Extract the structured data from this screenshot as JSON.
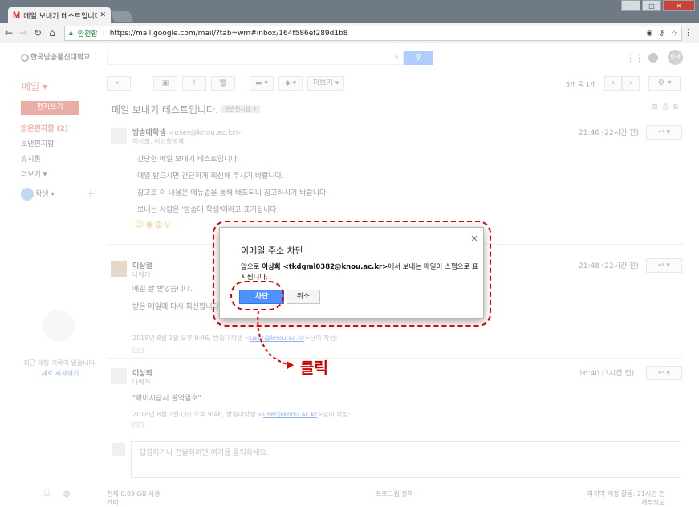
{
  "browser": {
    "tab_title": "메일 보내기 테스트입니다",
    "tab_logo": "M",
    "secure_label": "안전함",
    "url": "https://mail.google.com/mail/?tab=wm#inbox/164f586ef289d1b8"
  },
  "gmail": {
    "logo_text": "한국방송통신대학교",
    "mail_label": "메일 ▾",
    "compose_label": "편지쓰기",
    "more_label": "더보기 ▾",
    "pager_text": "3개 중 1개",
    "user_initials": "학생",
    "nav": [
      {
        "label": "받은편지함 (2)"
      },
      {
        "label": "보낸편지함"
      },
      {
        "label": "휴지통"
      },
      {
        "label": "더보기 ▾"
      }
    ],
    "side_user": "학생",
    "chat_empty": "최근 채팅 기록이 없습니다.",
    "chat_start": "새로 시작하기",
    "subject": "메일 보내기 테스트입니다.",
    "label_chip": "받은편지함",
    "messages": [
      {
        "from": "방송대학생",
        "email": "<user@knou.ac.kr>",
        "to": "이상희, 이상철에게",
        "time": "21:46 (22시간 전)",
        "lines": [
          "간단한 메일 보내기 테스트입니다.",
          "메일 받으시면 간단하게 회신해 주시기 바랍니다.",
          "참고로 이 내용은 메뉴얼을 통해 배포되니 참고하시기 바랍니다.",
          "보내는 사람은 '방송대 학생'이라고 표기됩니다."
        ]
      },
      {
        "from": "이상철",
        "to": "나에게",
        "time": "21:48 (22시간 전)",
        "lines": [
          "메일 잘 받았습니다.",
          "받은 메일에 다시 회신합니다."
        ],
        "quote_prefix": "2018년 8월 1일 오후 9:46, 방송대학생 <",
        "quote_link": "user@knou.ac.kr",
        "quote_suffix": ">님이 작성:"
      },
      {
        "from": "이상희",
        "to": "나에게",
        "time": "16:40 (3시간 전)",
        "lines": [
          "\"확이시습지 불역열호\""
        ],
        "quote_prefix": "2018년 8월 1일 (수) 오후 9:46, 방송대학생 <",
        "quote_link": "user@knou.ac.kr",
        "quote_suffix": ">님이 작성:"
      }
    ],
    "reply_placeholder": "답장하거나 전달하려면 여기를 클릭하세요.",
    "storage": "현재 0.89 GB 사용",
    "manage": "관리",
    "program_policy": "프로그램 정책",
    "last_activity": "마지막 계정 활동: 21시간 전",
    "details": "세부정보"
  },
  "dialog": {
    "title": "이메일 주소 차단",
    "text_prefix": "앞으로 ",
    "text_bold": "이상희 <tkdgml0382@knou.ac.kr>",
    "text_suffix": "에서 보내는 메일이 스팸으로 표시됩니다.",
    "confirm_label": "차단",
    "cancel_label": "취소",
    "close_label": "×"
  },
  "annotation": {
    "label": "클릭",
    "color": "#e00000"
  }
}
